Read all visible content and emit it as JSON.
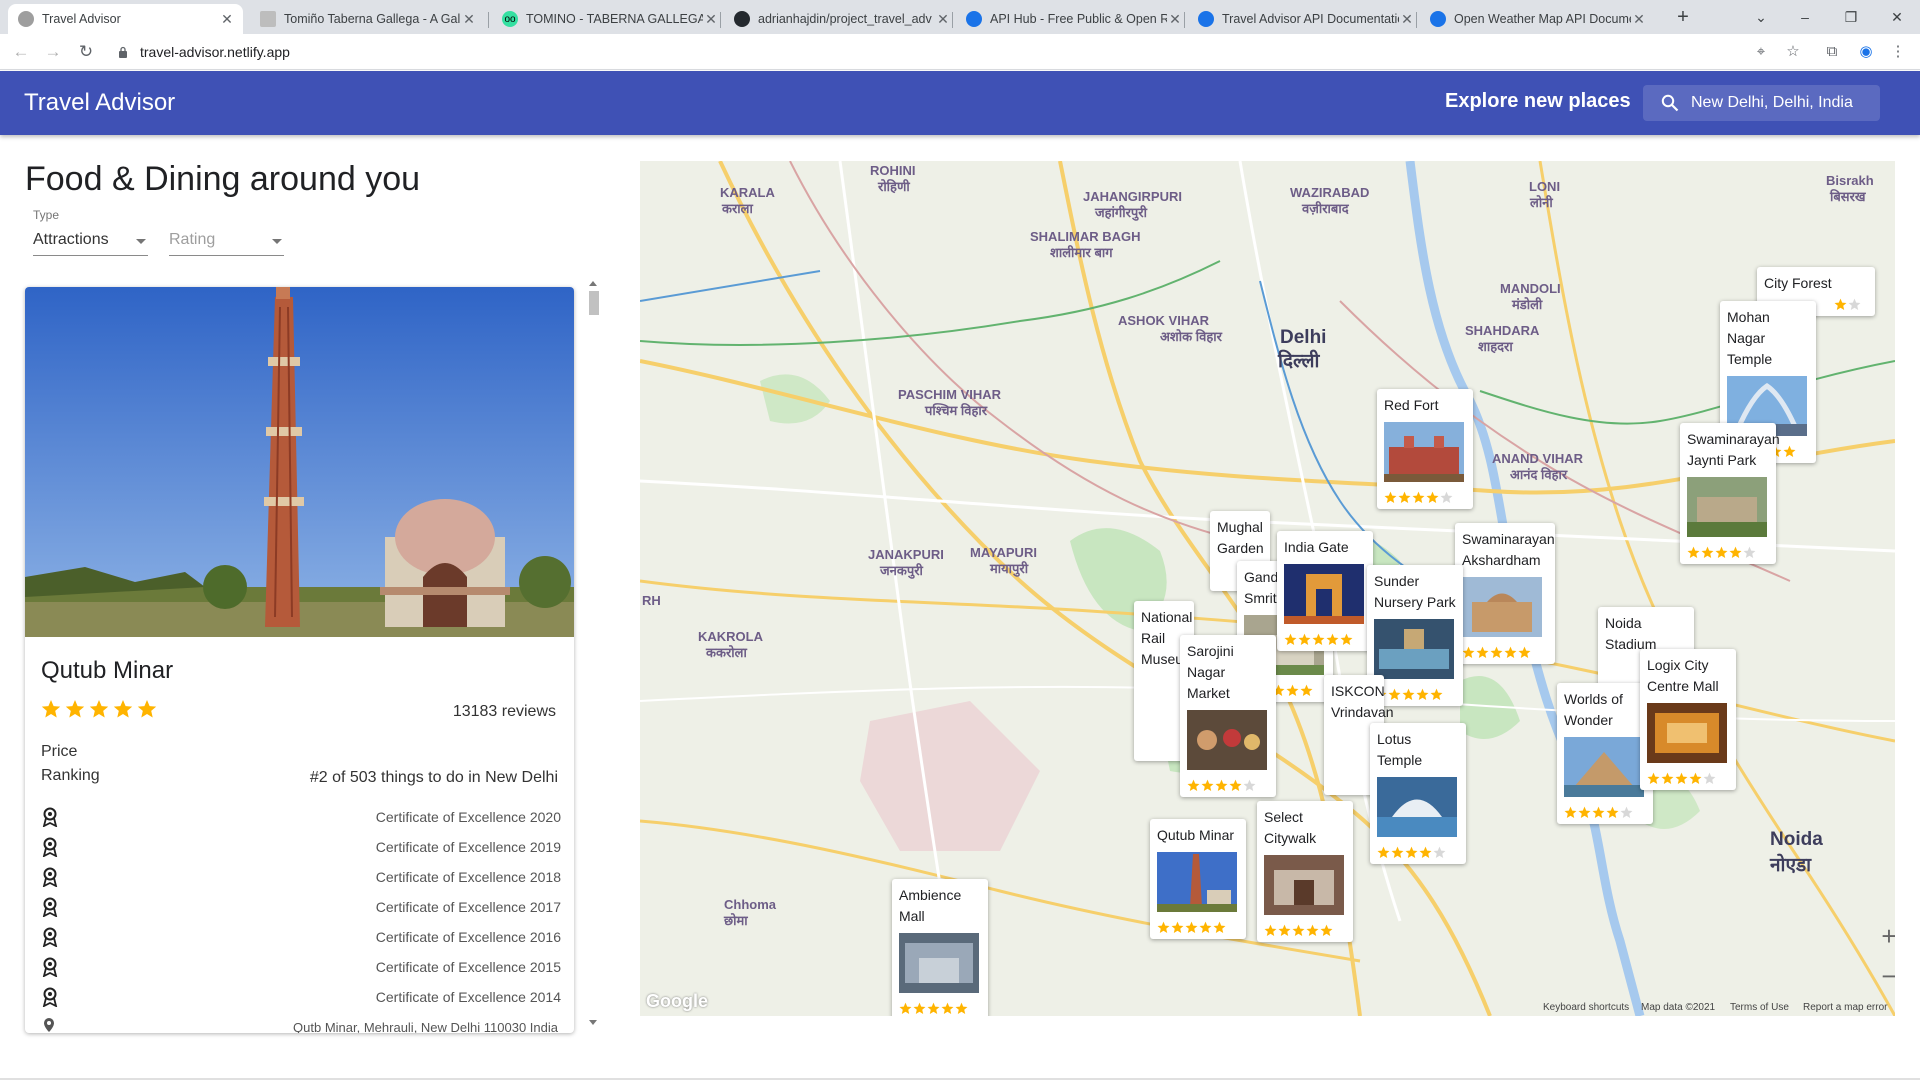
{
  "browser": {
    "tabs": [
      {
        "title": "Travel Advisor",
        "active": true
      },
      {
        "title": "Tomiño Taberna Gallega - A Gal"
      },
      {
        "title": "TOMINO - TABERNA GALLEGA, B"
      },
      {
        "title": "adrianhajdin/project_travel_adv"
      },
      {
        "title": "API Hub - Free Public & Open R"
      },
      {
        "title": "Travel Advisor API Documentatio"
      },
      {
        "title": "Open Weather Map API Docume"
      }
    ],
    "url": "travel-advisor.netlify.app"
  },
  "header": {
    "title": "Travel Advisor",
    "explore_label": "Explore new places",
    "search_value": "New Delhi, Delhi, India"
  },
  "left": {
    "title": "Food & Dining around you",
    "type_label": "Type",
    "type_value": "Attractions",
    "rating_placeholder": "Rating"
  },
  "card": {
    "name": "Qutub Minar",
    "rating": 5,
    "reviews": "13183 reviews",
    "price_label": "Price",
    "ranking_label": "Ranking",
    "ranking_value": "#2 of 503 things to do in New Delhi",
    "awards": [
      "Certificate of Excellence 2020",
      "Certificate of Excellence 2019",
      "Certificate of Excellence 2018",
      "Certificate of Excellence 2017",
      "Certificate of Excellence 2016",
      "Certificate of Excellence 2015",
      "Certificate of Excellence 2014"
    ],
    "address": "Qutb Minar, Mehrauli, New Delhi 110030 India"
  },
  "map": {
    "areas": [
      "ROHINI",
      "रोहिणी",
      "KARALA",
      "कराला",
      "JAHANGIRPURI",
      "जहांगीरपुरी",
      "WAZIRABAD",
      "वज़ीराबाद",
      "LONI",
      "लोनी",
      "SHALIMAR BAGH",
      "शालीमार बाग",
      "ASHOK VIHAR",
      "अशोक विहार",
      "Delhi",
      "दिल्ली",
      "MANDOLI",
      "मंडोली",
      "SHAHDARA",
      "शाहदरा",
      "PASCHIM VIHAR",
      "पश्चिम विहार",
      "ANAND VIHAR",
      "आनंद विहार",
      "JANAKPURI",
      "जनकपुरी",
      "MAYAPURI",
      "मायापुरी",
      "KAKROLA",
      "ककरोला",
      "Chhoma",
      "छोमा",
      "Noida",
      "नोएडा",
      "RH",
      "Bisrakh",
      "बिसरख"
    ],
    "markers": [
      {
        "name": "City Forest",
        "rating": 4
      },
      {
        "name": "Mohan Nagar Temple",
        "rating": 5
      },
      {
        "name": "Red Fort",
        "rating": 4
      },
      {
        "name": "Swaminarayan Jaynti Park",
        "rating": 4
      },
      {
        "name": "India Gate",
        "rating": 5
      },
      {
        "name": "Swaminarayan Akshardham",
        "rating": 5
      },
      {
        "name": "Sunder Nursery Park",
        "rating": 5
      },
      {
        "name": "National Rail Museum",
        "rating": 4
      },
      {
        "name": "Sarojini Nagar Market",
        "rating": 4
      },
      {
        "name": "Noida Stadium",
        "rating": 4
      },
      {
        "name": "Logix City Centre Mall",
        "rating": 4
      },
      {
        "name": "Worlds of Wonder",
        "rating": 4
      },
      {
        "name": "Lotus Temple",
        "rating": 4
      },
      {
        "name": "Select Citywalk",
        "rating": 5
      },
      {
        "name": "Qutub Minar",
        "rating": 5
      },
      {
        "name": "Ambience Mall",
        "rating": 5
      },
      {
        "name": "Mughal Garden",
        "rating": 5
      },
      {
        "name": "Gandhi Smriti",
        "rating": 5
      },
      {
        "name": "ISKCON Vrindavan",
        "rating": 4
      }
    ],
    "footer": {
      "google": "Google",
      "shortcuts": "Keyboard shortcuts",
      "mapdata": "Map data ©2021",
      "terms": "Terms of Use",
      "report": "Report a map error"
    },
    "zoom_in": "+",
    "zoom_out": "−"
  },
  "colors": {
    "appbar": "#3f51b5",
    "star": "#ffb400",
    "star_empty": "#d8d8d8"
  }
}
